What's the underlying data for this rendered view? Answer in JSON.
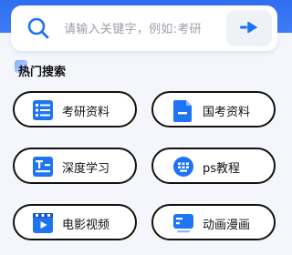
{
  "search": {
    "placeholder": "请输入关键字，例如:考研",
    "icon": "search-icon",
    "go_icon": "arrow-right-icon",
    "accent": "#2f6ff0"
  },
  "hot": {
    "title": "热门搜索"
  },
  "categories": [
    {
      "label": "考研资料",
      "icon": "list-document-icon"
    },
    {
      "label": "国考资料",
      "icon": "file-icon"
    },
    {
      "label": "深度学习",
      "icon": "text-document-icon"
    },
    {
      "label": "ps教程",
      "icon": "keypad-icon"
    },
    {
      "label": "电影视频",
      "icon": "film-icon"
    },
    {
      "label": "动画漫画",
      "icon": "tv-icon"
    }
  ],
  "colors": {
    "icon_blue": "#1f74f4",
    "header_blue": "#2f6ff0",
    "tile_border": "#111111"
  }
}
